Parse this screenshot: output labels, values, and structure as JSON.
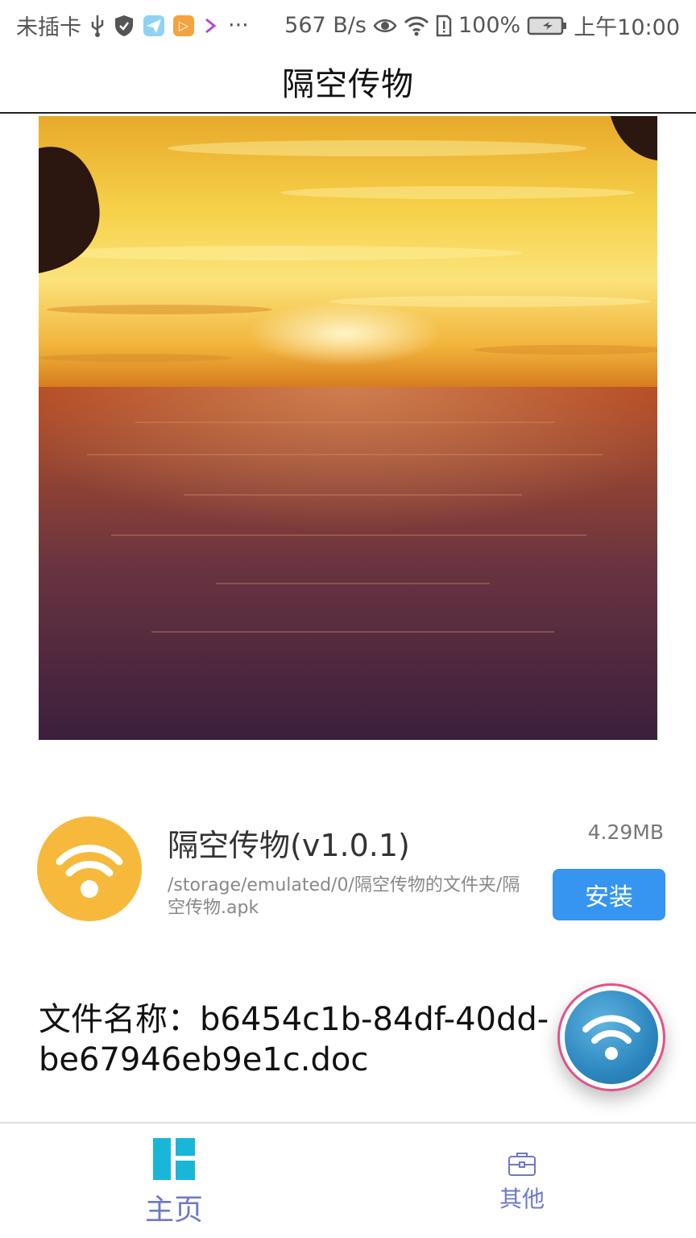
{
  "status_bar": {
    "carrier": "未插卡",
    "more": "···",
    "net_speed": "567 B/s",
    "battery": "100%",
    "time": "上午10:00"
  },
  "header": {
    "title": "隔空传物"
  },
  "file_card": {
    "app_name": "隔空传物(v1.0.1)",
    "size": "4.29MB",
    "path": "/storage/emulated/0/隔空传物的文件夹/隔空传物.apk",
    "install_label": "安装"
  },
  "file_name": {
    "text": "文件名称：b6454c1b-84df-40dd-be67946eb9e1c.doc"
  },
  "bottom_nav": {
    "home_label": "主页",
    "other_label": "其他"
  },
  "colors": {
    "accent_blue": "#3595f0",
    "icon_orange": "#f7b93b",
    "nav_label": "#6e78c7",
    "nav_icon_active": "#19b6d8",
    "fab_ring": "#e2528a"
  }
}
